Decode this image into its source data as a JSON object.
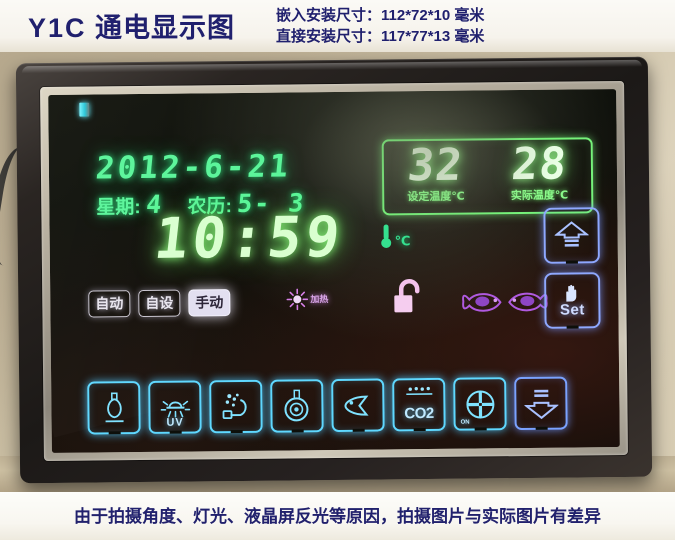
{
  "header": {
    "model": "Y1C",
    "title_cn": "通电显示图",
    "dim_embedded": "嵌入安装尺寸：112*72*10 毫米",
    "dim_direct": "直接安装尺寸：117*77*13 毫米"
  },
  "lcd": {
    "date": "2012-6-21",
    "weekday_label": "星期:",
    "weekday_value": "4",
    "lunar_label": "农历:",
    "lunar_value": "5- 3",
    "time": "10:59",
    "thermo_unit": "℃",
    "temperature": {
      "set_value": "32",
      "set_label": "设定温度℃",
      "actual_value": "28",
      "actual_label": "实际温度℃"
    },
    "modes": [
      {
        "label": "自动",
        "state": "off"
      },
      {
        "label": "自设",
        "state": "off"
      },
      {
        "label": "手动",
        "state": "on"
      }
    ],
    "heat_label": "加热",
    "side_buttons": [
      {
        "name": "up",
        "label": ""
      },
      {
        "name": "set",
        "label": "Set"
      }
    ],
    "icon_buttons": [
      {
        "name": "lamp",
        "label": ""
      },
      {
        "name": "uv-lamp",
        "label": "UV"
      },
      {
        "name": "air-pump",
        "label": ""
      },
      {
        "name": "water-pump",
        "label": ""
      },
      {
        "name": "feeding",
        "label": ""
      },
      {
        "name": "co2",
        "label": "CO2"
      },
      {
        "name": "power-socket",
        "label": "ON"
      },
      {
        "name": "down",
        "label": ""
      }
    ]
  },
  "footer": {
    "caption": "由于拍摄角度、灯光、液晶屏反光等原因，拍摄图片与实际图片有差异"
  },
  "colors": {
    "title_blue": "#20206e",
    "lcd_green": "#5bf59a",
    "lcd_white_green": "#e9ffe4",
    "icon_cyan": "#5fd8ff",
    "icon_blue": "#8ea8ff",
    "fish_purple": "#b05ae0",
    "lock_pink": "#f0b9e8"
  }
}
